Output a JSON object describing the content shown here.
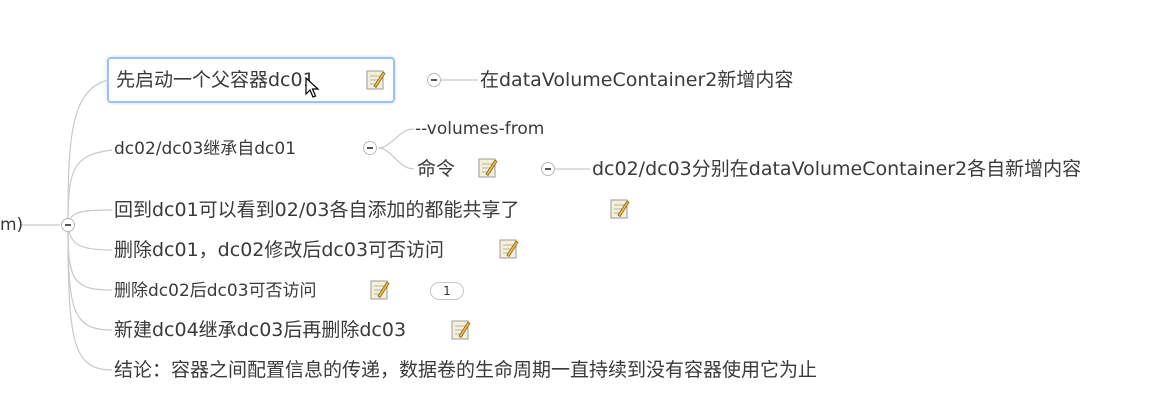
{
  "root": {
    "label_fragment": "m)"
  },
  "nodes": [
    {
      "id": "n1",
      "label": "先启动一个父容器dc01",
      "has_note": true,
      "selected": true,
      "child": {
        "label": "在dataVolumeContainer2新增内容"
      }
    },
    {
      "id": "n2",
      "label": "dc02/dc03继承自dc01",
      "has_note": false,
      "children": [
        {
          "label": "--volumes-from"
        },
        {
          "label": "命令",
          "has_note": true,
          "child": {
            "label": "dc02/dc03分别在dataVolumeContainer2各自新增内容"
          }
        }
      ]
    },
    {
      "id": "n3",
      "label": "回到dc01可以看到02/03各自添加的都能共享了",
      "has_note": true
    },
    {
      "id": "n4",
      "label": "删除dc01，dc02修改后dc03可否访问",
      "has_note": true
    },
    {
      "id": "n5",
      "label": "删除dc02后dc03可否访问",
      "has_note": true,
      "badge": "1"
    },
    {
      "id": "n6",
      "label": "新建dc04继承dc03后再删除dc03",
      "has_note": true
    },
    {
      "id": "n7",
      "label": "结论：容器之间配置信息的传递，数据卷的生命周期一直持续到没有容器使用它为止",
      "has_note": false
    }
  ],
  "colors": {
    "link": "#c9c9c9",
    "selection_border": "#9cc3ee",
    "text": "#3a3a3a"
  },
  "icons": {
    "note": "note-pencil-icon",
    "collapse": "collapse-minus-icon",
    "cursor": "mouse-pointer-icon"
  }
}
